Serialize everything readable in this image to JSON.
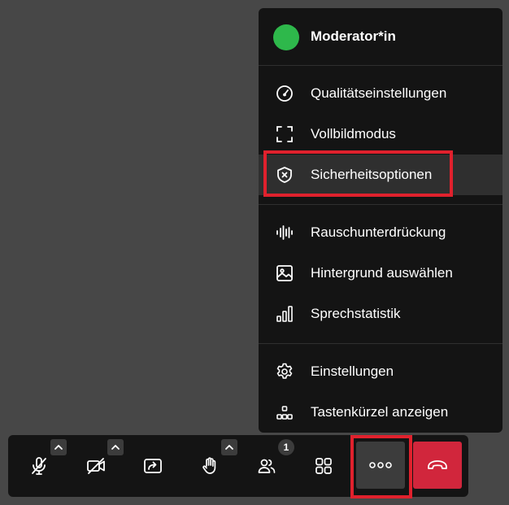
{
  "menu": {
    "header": {
      "name": "Moderator*in",
      "status_color": "#2eb84b"
    },
    "items": [
      {
        "label": "Qualitätseinstellungen",
        "icon": "gauge-icon"
      },
      {
        "label": "Vollbildmodus",
        "icon": "fullscreen-icon"
      },
      {
        "label": "Sicherheitsoptionen",
        "icon": "shield-icon",
        "highlighted": true
      },
      {
        "label": "Rauschunterdrückung",
        "icon": "noise-suppression-icon"
      },
      {
        "label": "Hintergrund auswählen",
        "icon": "image-icon"
      },
      {
        "label": "Sprechstatistik",
        "icon": "bar-chart-icon"
      },
      {
        "label": "Einstellungen",
        "icon": "gear-icon"
      },
      {
        "label": "Tastenkürzel anzeigen",
        "icon": "keyboard-shortcuts-icon"
      }
    ]
  },
  "toolbar": {
    "buttons": [
      {
        "name": "microphone-muted",
        "icon": "microphone-muted-icon",
        "has_caret": true
      },
      {
        "name": "camera-off",
        "icon": "camera-off-icon",
        "has_caret": true
      },
      {
        "name": "screen-share",
        "icon": "screen-share-icon"
      },
      {
        "name": "raise-hand",
        "icon": "hand-icon",
        "has_caret": true
      },
      {
        "name": "participants",
        "icon": "participants-icon",
        "badge": "1"
      },
      {
        "name": "tile-view",
        "icon": "tile-view-icon"
      },
      {
        "name": "more-actions",
        "icon": "more-dots-icon",
        "active": true
      },
      {
        "name": "hang-up",
        "icon": "hang-up-icon",
        "color": "#d1263c"
      }
    ]
  },
  "colors": {
    "background": "#474747",
    "panel": "#141414",
    "highlight": "#2f2f2f",
    "annotation_red": "#e0212d"
  }
}
